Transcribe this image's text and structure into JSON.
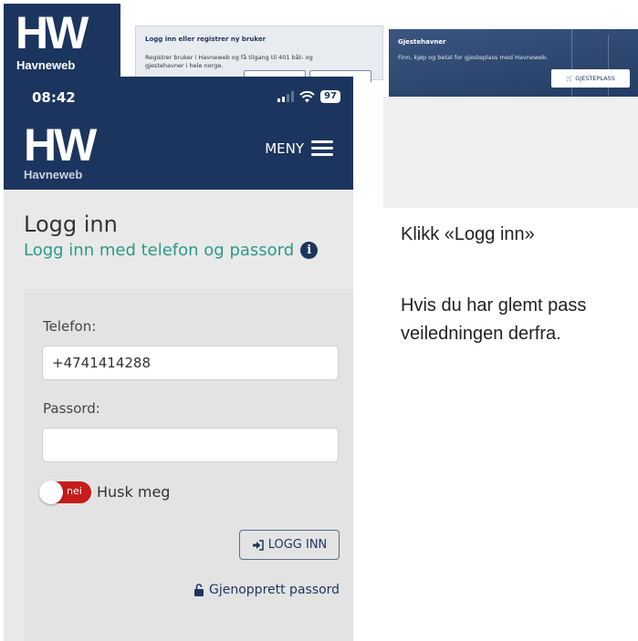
{
  "desktop": {
    "logo_text": "HW",
    "logo_sub": "Havneweb",
    "register_title": "Logg inn eller registrer ny bruker",
    "register_body": "Registrer bruker i Havneweb og få tilgang til 401 båt- og gjestehavner i hele norge.",
    "guest_title": "Gjestehavner",
    "guest_body": "Finn, kjøp og betal for gjesteplass med Havneweb.",
    "guest_button": "GJESTEPLASS"
  },
  "phone": {
    "status_time": "08:42",
    "battery": "97",
    "logo_text": "HW",
    "logo_sub": "Havneweb",
    "menu_label": "MENY"
  },
  "login": {
    "title": "Logg inn",
    "subtitle": "Logg inn med telefon og passord",
    "phone_label": "Telefon:",
    "phone_value": "+4741414288",
    "password_label": "Passord:",
    "password_value": "",
    "toggle_state": "nei",
    "remember_label": "Husk meg",
    "login_button": "LOGG INN",
    "reset_link": "Gjenopprett passord"
  },
  "instructions": {
    "line1": "Klikk «Logg inn»",
    "line2a": "Hvis du har glemt pass",
    "line2b": "veiledningen derfra."
  },
  "colors": {
    "brand_navy": "#1c355e",
    "teal": "#2a9a8a",
    "toggle_red": "#c61b1b"
  }
}
